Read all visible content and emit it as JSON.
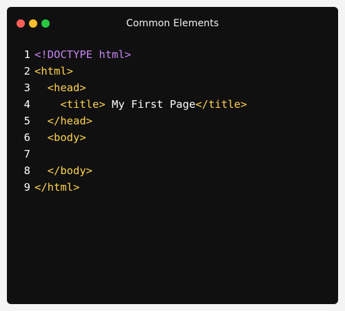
{
  "window": {
    "title": "Common Elements",
    "traffic_lights": {
      "close_color": "#ff5f57",
      "minimize_color": "#febc2e",
      "zoom_color": "#28c840"
    }
  },
  "colors": {
    "doctype": "#c585f5",
    "tag": "#ffd350",
    "text": "#ffffff"
  },
  "code_lines": [
    {
      "number": "1",
      "indent": "",
      "tokens": [
        {
          "type": "doctype",
          "text": "<!DOCTYPE html>"
        }
      ]
    },
    {
      "number": "2",
      "indent": "",
      "tokens": [
        {
          "type": "tag",
          "text": "<html>"
        }
      ]
    },
    {
      "number": "3",
      "indent": "  ",
      "tokens": [
        {
          "type": "tag",
          "text": "<head>"
        }
      ]
    },
    {
      "number": "4",
      "indent": "    ",
      "tokens": [
        {
          "type": "tag",
          "text": "<title>"
        },
        {
          "type": "text",
          "text": " My First Page"
        },
        {
          "type": "tag",
          "text": "</title>"
        }
      ]
    },
    {
      "number": "5",
      "indent": "  ",
      "tokens": [
        {
          "type": "tag",
          "text": "</head>"
        }
      ]
    },
    {
      "number": "6",
      "indent": "  ",
      "tokens": [
        {
          "type": "tag",
          "text": "<body>"
        }
      ]
    },
    {
      "number": "7",
      "indent": "",
      "tokens": []
    },
    {
      "number": "8",
      "indent": "  ",
      "tokens": [
        {
          "type": "tag",
          "text": "</body>"
        }
      ]
    },
    {
      "number": "9",
      "indent": "",
      "tokens": [
        {
          "type": "tag",
          "text": "</html>"
        }
      ]
    }
  ]
}
